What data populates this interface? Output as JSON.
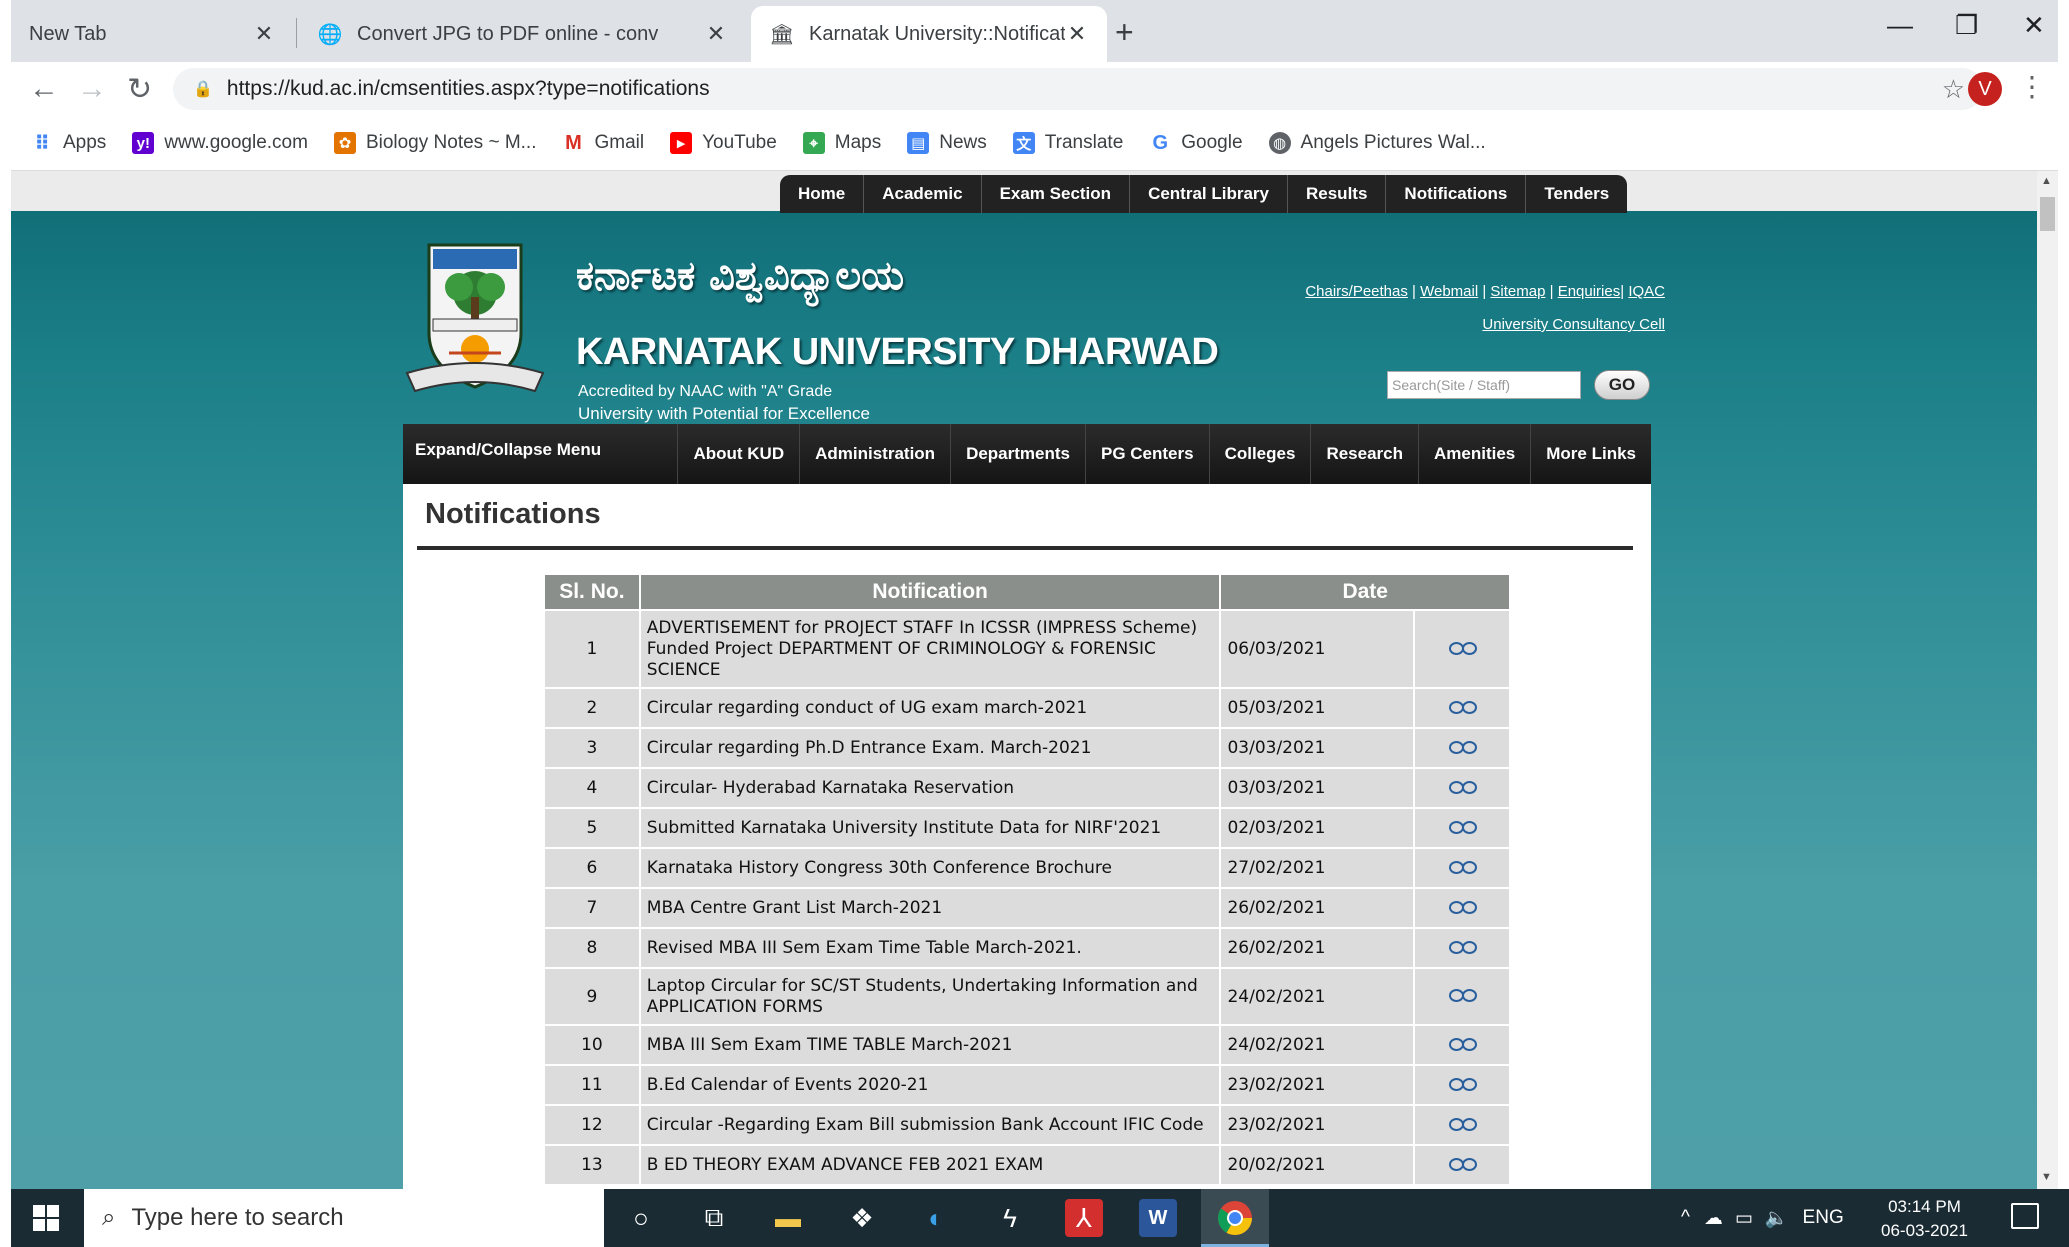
{
  "browser": {
    "tabs": [
      {
        "title": "New Tab",
        "active": false
      },
      {
        "title": "Convert JPG to PDF online - conv",
        "active": false
      },
      {
        "title": "Karnatak University::Notifications",
        "active": true
      }
    ],
    "url": "https://kud.ac.in/cmsentities.aspx?type=notifications",
    "profile_initial": "V",
    "bookmarks": [
      {
        "label": "Apps",
        "icon": "apps-grid-icon",
        "color": "#4285f4"
      },
      {
        "label": "www.google.com",
        "icon": "yahoo-icon",
        "color": "#6001d2"
      },
      {
        "label": "Biology Notes ~ M...",
        "icon": "biology-icon",
        "color": "#e37400"
      },
      {
        "label": "Gmail",
        "icon": "gmail-icon",
        "color": "#d93025"
      },
      {
        "label": "YouTube",
        "icon": "youtube-icon",
        "color": "#ff0000"
      },
      {
        "label": "Maps",
        "icon": "maps-icon",
        "color": "#34a853"
      },
      {
        "label": "News",
        "icon": "news-icon",
        "color": "#4285f4"
      },
      {
        "label": "Translate",
        "icon": "translate-icon",
        "color": "#4285f4"
      },
      {
        "label": "Google",
        "icon": "google-icon",
        "color": "#4285f4"
      },
      {
        "label": "Angels Pictures Wal...",
        "icon": "globe-icon",
        "color": "#5f6368"
      }
    ]
  },
  "site": {
    "top_nav": [
      "Home",
      "Academic",
      "Exam Section",
      "Central Library",
      "Results",
      "Notifications",
      "Tenders"
    ],
    "kannada_title": "ಕರ್ನಾಟಕ ವಿಶ್ವವಿದ್ಯಾಲಯ",
    "title": "KARNATAK UNIVERSITY DHARWAD",
    "accreditation": "Accredited by NAAC with \"A\" Grade",
    "tagline": "University with Potential  for Excellence",
    "links_row1": [
      "Chairs/Peethas",
      "Webmail",
      "Sitemap",
      "Enquiries",
      "IQAC"
    ],
    "links_row2": "University Consultancy Cell",
    "search_placeholder": "Search(Site / Staff)",
    "go_label": "GO",
    "expand_label": "Expand/Collapse Menu",
    "main_menu": [
      "About KUD",
      "Administration",
      "Departments",
      "PG Centers",
      "Colleges",
      "Research",
      "Amenities",
      "More Links"
    ]
  },
  "content": {
    "heading": "Notifications",
    "columns": [
      "Sl. No.",
      "Notification",
      "Date"
    ],
    "rows": [
      {
        "sl": "1",
        "text": "ADVERTISEMENT for PROJECT STAFF In ICSSR (IMPRESS Scheme) Funded Project DEPARTMENT OF CRIMINOLOGY & FORENSIC SCIENCE",
        "date": "06/03/2021"
      },
      {
        "sl": "2",
        "text": "Circular regarding conduct of UG exam march-2021",
        "date": "05/03/2021"
      },
      {
        "sl": "3",
        "text": "Circular regarding Ph.D Entrance Exam. March-2021",
        "date": "03/03/2021"
      },
      {
        "sl": "4",
        "text": "Circular- Hyderabad Karnataka Reservation",
        "date": "03/03/2021"
      },
      {
        "sl": "5",
        "text": "Submitted Karnataka University Institute Data for NIRF'2021",
        "date": "02/03/2021"
      },
      {
        "sl": "6",
        "text": "Karnataka History Congress 30th Conference Brochure",
        "date": "27/02/2021"
      },
      {
        "sl": "7",
        "text": "MBA Centre Grant List March-2021",
        "date": "26/02/2021"
      },
      {
        "sl": "8",
        "text": "Revised MBA III Sem Exam Time Table March-2021.",
        "date": "26/02/2021"
      },
      {
        "sl": "9",
        "text": "Laptop Circular for SC/ST Students, Undertaking Information and APPLICATION FORMS",
        "date": "24/02/2021"
      },
      {
        "sl": "10",
        "text": "MBA III Sem Exam TIME TABLE March-2021",
        "date": "24/02/2021"
      },
      {
        "sl": "11",
        "text": "B.Ed Calendar of Events 2020-21",
        "date": "23/02/2021"
      },
      {
        "sl": "12",
        "text": "Circular -Regarding Exam Bill submission Bank Account IFIC Code",
        "date": "23/02/2021"
      },
      {
        "sl": "13",
        "text": "B ED THEORY EXAM ADVANCE FEB 2021 EXAM",
        "date": "20/02/2021"
      }
    ]
  },
  "taskbar": {
    "search_placeholder": "Type here to search",
    "language": "ENG",
    "time": "03:14 PM",
    "date": "06-03-2021"
  }
}
